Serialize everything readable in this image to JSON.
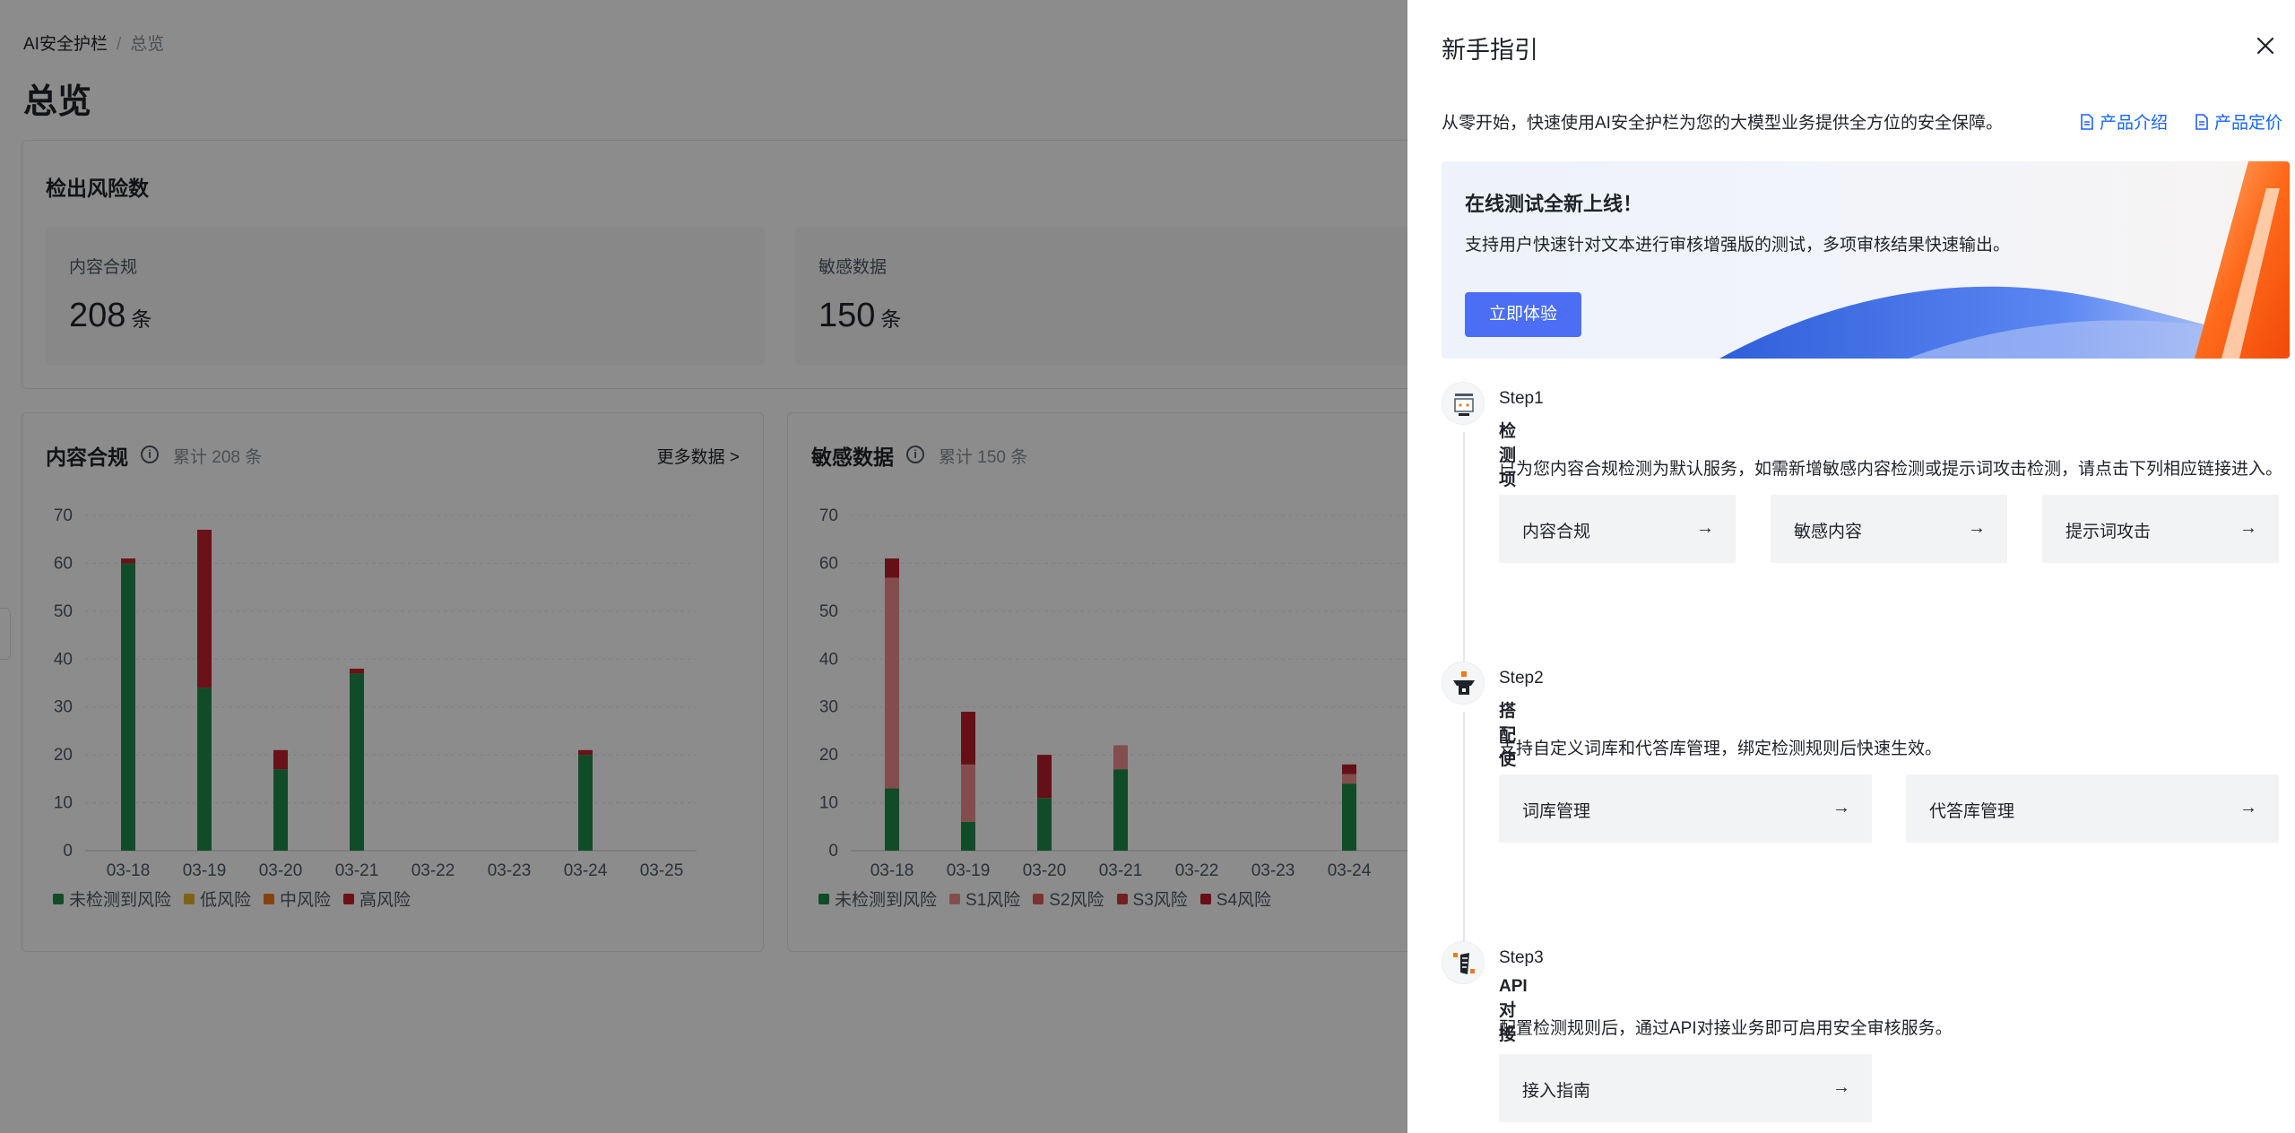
{
  "breadcrumb": {
    "root": "AI安全护栏",
    "separator": "/",
    "current": "总览"
  },
  "page_title": "总览",
  "risk_summary": {
    "title": "检出风险数",
    "stats": [
      {
        "label": "内容合规",
        "value": "208",
        "unit": "条"
      },
      {
        "label": "敏感数据",
        "value": "150",
        "unit": "条"
      }
    ]
  },
  "content_chart": {
    "title": "内容合规",
    "total": "累计 208 条",
    "more": "更多数据 >"
  },
  "sensitive_chart": {
    "title": "敏感数据",
    "total": "累计 150 条"
  },
  "chart_data": [
    {
      "type": "bar",
      "stacked": true,
      "categories": [
        "03-18",
        "03-19",
        "03-20",
        "03-21",
        "03-22",
        "03-23",
        "03-24",
        "03-25"
      ],
      "ylim": [
        0,
        70
      ],
      "yticks": [
        0,
        10,
        20,
        30,
        40,
        50,
        60,
        70
      ],
      "grid": true,
      "legend_position": "bottom-left",
      "series": [
        {
          "name": "未检测到风险",
          "color": "#1f8a4c",
          "values": [
            60,
            34,
            17,
            37,
            0,
            0,
            20,
            0
          ]
        },
        {
          "name": "低风险",
          "color": "#e6b422",
          "values": [
            0,
            0,
            0,
            0,
            0,
            0,
            0,
            0
          ]
        },
        {
          "name": "中风险",
          "color": "#f0781e",
          "values": [
            0,
            0,
            0,
            0,
            0,
            0,
            0,
            0
          ]
        },
        {
          "name": "高风险",
          "color": "#c4202a",
          "values": [
            1,
            33,
            4,
            1,
            0,
            0,
            1,
            0
          ]
        }
      ]
    },
    {
      "type": "bar",
      "stacked": true,
      "categories": [
        "03-18",
        "03-19",
        "03-20",
        "03-21",
        "03-22",
        "03-23",
        "03-24"
      ],
      "ylim": [
        0,
        70
      ],
      "yticks": [
        0,
        10,
        20,
        30,
        40,
        50,
        60,
        70
      ],
      "grid": true,
      "legend_position": "bottom-left",
      "series": [
        {
          "name": "未检测到风险",
          "color": "#1f8a4c",
          "values": [
            13,
            6,
            11,
            17,
            0,
            0,
            14
          ]
        },
        {
          "name": "S1风险",
          "color": "#f08c8c",
          "values": [
            44,
            12,
            0,
            5,
            0,
            0,
            2
          ]
        },
        {
          "name": "S2风险",
          "color": "#e35a5a",
          "values": [
            0,
            0,
            0,
            0,
            0,
            0,
            0
          ]
        },
        {
          "name": "S3风险",
          "color": "#d23a3a",
          "values": [
            0,
            0,
            0,
            0,
            0,
            0,
            0
          ]
        },
        {
          "name": "S4风险",
          "color": "#b81e2a",
          "values": [
            4,
            11,
            9,
            0,
            0,
            0,
            2
          ]
        }
      ]
    }
  ],
  "drawer": {
    "title": "新手指引",
    "intro": "从零开始，快速使用AI安全护栏为您的大模型业务提供全方位的安全保障。",
    "links": [
      "产品介绍",
      "产品定价"
    ],
    "banner": {
      "title": "在线测试全新上线！",
      "desc": "支持用户快速针对文本进行审核增强版的测试，多项审核结果快速输出。",
      "button": "立即体验"
    },
    "steps": [
      {
        "label": "Step1",
        "name": "检测项配置",
        "desc": "已为您内容合规检测为默认服务，如需新增敏感内容检测或提示词攻击检测，请点击下列相应链接进入。",
        "actions": [
          "内容合规",
          "敏感内容",
          "提示词攻击"
        ]
      },
      {
        "label": "Step2",
        "name": "搭配使用",
        "desc": "支持自定义词库和代答库管理，绑定检测规则后快速生效。",
        "actions": [
          "词库管理",
          "代答库管理"
        ]
      },
      {
        "label": "Step3",
        "name": "API对接",
        "desc": "配置检测规则后，通过API对接业务即可启用安全审核服务。",
        "actions": [
          "接入指南"
        ]
      }
    ],
    "arrow": "→"
  },
  "colors": {
    "accent": "#1664ff",
    "primary_button": "#4c6ef5",
    "mask": "rgba(0,0,0,0.45)"
  }
}
